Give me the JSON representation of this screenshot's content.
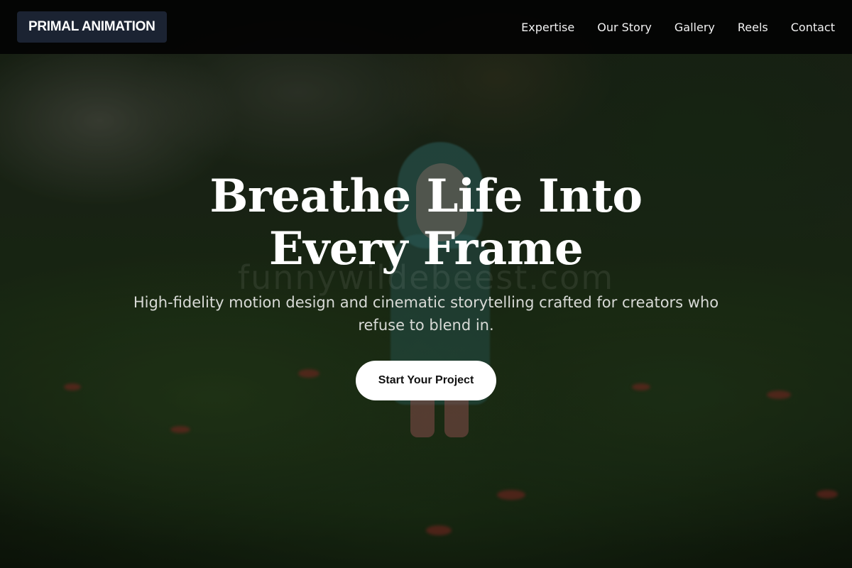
{
  "header": {
    "logo_text": "PRIMAL ANIMATION",
    "nav_items": [
      {
        "label": "Expertise"
      },
      {
        "label": "Our Story"
      },
      {
        "label": "Gallery"
      },
      {
        "label": "Reels"
      },
      {
        "label": "Contact"
      }
    ]
  },
  "hero": {
    "title": "Breathe Life Into Every Frame",
    "subtitle": "High-fidelity motion design and cinematic storytelling crafted for creators who refuse to blend in.",
    "cta_label": "Start Your Project",
    "watermark_text": "funnywildebeest.com",
    "background_image": "toy-figure-in-grass-photo"
  },
  "colors": {
    "header_bg": "#040404",
    "logo_bg": "#1b2332",
    "cta_bg": "#ffffff",
    "cta_text": "#111111",
    "title_text": "#ffffff",
    "subtitle_text": "#d8dad6"
  }
}
